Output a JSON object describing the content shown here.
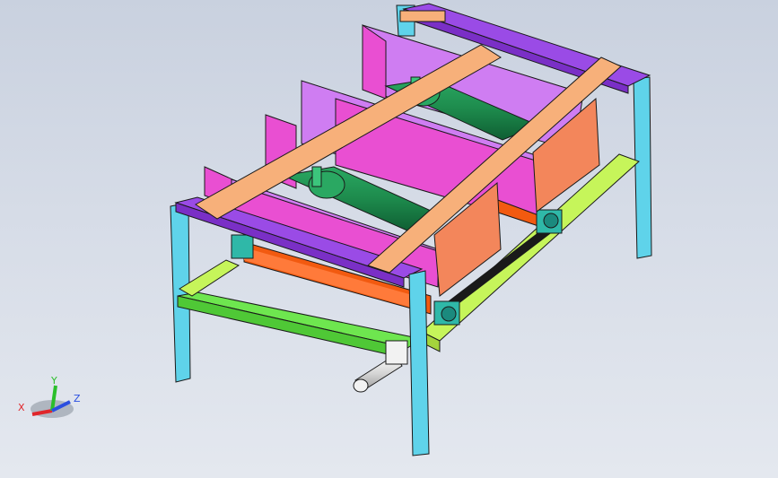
{
  "viewport": {
    "background_top": "#c9d1df",
    "background_bottom": "#e4e8ef"
  },
  "triad": {
    "x_label": "X",
    "y_label": "Y",
    "z_label": "Z",
    "x_color": "#e0262b",
    "y_color": "#2bbf2b",
    "z_color": "#2b4fe0"
  },
  "model": {
    "frame_color": "#5fd3ea",
    "crossbar_color": "#f7b07a",
    "top_rail_color": "#9a4be6",
    "bottom_rail_color": "#6ee64f",
    "side_rail_color": "#c6f55a",
    "chute_color": "#e94fd2",
    "chute_inner_color": "#cf7df2",
    "drum_color": "#1d8a4c",
    "plate_color": "#f3865b",
    "base_color": "#f25a10",
    "bearing_color": "#2fb8a8",
    "motor_color": "#e8e8e8"
  }
}
